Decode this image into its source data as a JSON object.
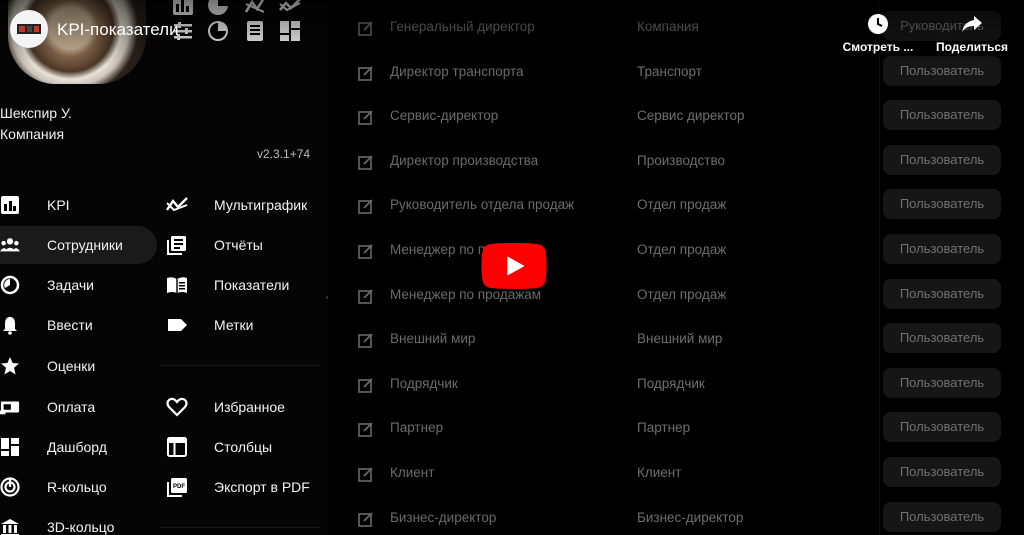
{
  "video": {
    "title": "KPI-показатели",
    "watch_later_label": "Смотреть ...",
    "share_label": "Поделиться"
  },
  "user": {
    "name": "Шекспир У.",
    "company": "Компания",
    "version": "v2.3.1+74"
  },
  "nav_left": [
    {
      "label": "KPI",
      "icon": "kpi-bar-chart-icon"
    },
    {
      "label": "Сотрудники",
      "icon": "people-icon",
      "active": true
    },
    {
      "label": "Задачи",
      "icon": "tasks-icon"
    },
    {
      "label": "Ввести",
      "icon": "bell-input-icon"
    },
    {
      "label": "Оценки",
      "icon": "star-icon"
    },
    {
      "label": "Оплата",
      "icon": "payment-icon"
    },
    {
      "label": "Дашборд",
      "icon": "dashboard-icon"
    },
    {
      "label": "R-кольцо",
      "icon": "r-ring-icon"
    },
    {
      "label": "3D-кольцо",
      "icon": "3d-ring-icon"
    }
  ],
  "nav_right": [
    {
      "label": "Мультиграфик",
      "icon": "multichart-icon"
    },
    {
      "label": "Отчёты",
      "icon": "reports-icon"
    },
    {
      "label": "Показатели",
      "icon": "indicators-icon"
    },
    {
      "label": "Метки",
      "icon": "label-tag-icon"
    },
    {
      "label": "Избранное",
      "icon": "heart-icon"
    },
    {
      "label": "Столбцы",
      "icon": "columns-icon"
    },
    {
      "label": "Экспорт в PDF",
      "icon": "pdf-icon"
    }
  ],
  "rows": [
    {
      "name": "Генеральный директор",
      "dept": "Компания",
      "role": "Руководитель"
    },
    {
      "name": "Директор транспорта",
      "dept": "Транспорт",
      "role": "Пользователь"
    },
    {
      "name": "Сервис-директор",
      "dept": "Сервис директор",
      "role": "Пользователь"
    },
    {
      "name": "Директор производства",
      "dept": "Производство",
      "role": "Пользователь"
    },
    {
      "name": "Руководитель отдела продаж",
      "dept": "Отдел продаж",
      "role": "Пользователь"
    },
    {
      "name": "Менеджер по продажам",
      "dept": "Отдел продаж",
      "role": "Пользователь"
    },
    {
      "name": "Менеджер по продажам",
      "dept": "Отдел продаж",
      "role": "Пользователь"
    },
    {
      "name": "Внешний мир",
      "dept": "Внешний мир",
      "role": "Пользователь"
    },
    {
      "name": "Подрядчик",
      "dept": "Подрядчик",
      "role": "Пользователь"
    },
    {
      "name": "Партнер",
      "dept": "Партнер",
      "role": "Пользователь"
    },
    {
      "name": "Клиент",
      "dept": "Клиент",
      "role": "Пользователь"
    },
    {
      "name": "Бизнес-директор",
      "dept": "Бизнес-директор",
      "role": "Пользователь"
    }
  ],
  "colors": {
    "background": "#000000",
    "text": "#f3f3f3",
    "muted_text": "#6b6b6b",
    "pill_bg": "#161616",
    "play_red": "#ff0000"
  }
}
